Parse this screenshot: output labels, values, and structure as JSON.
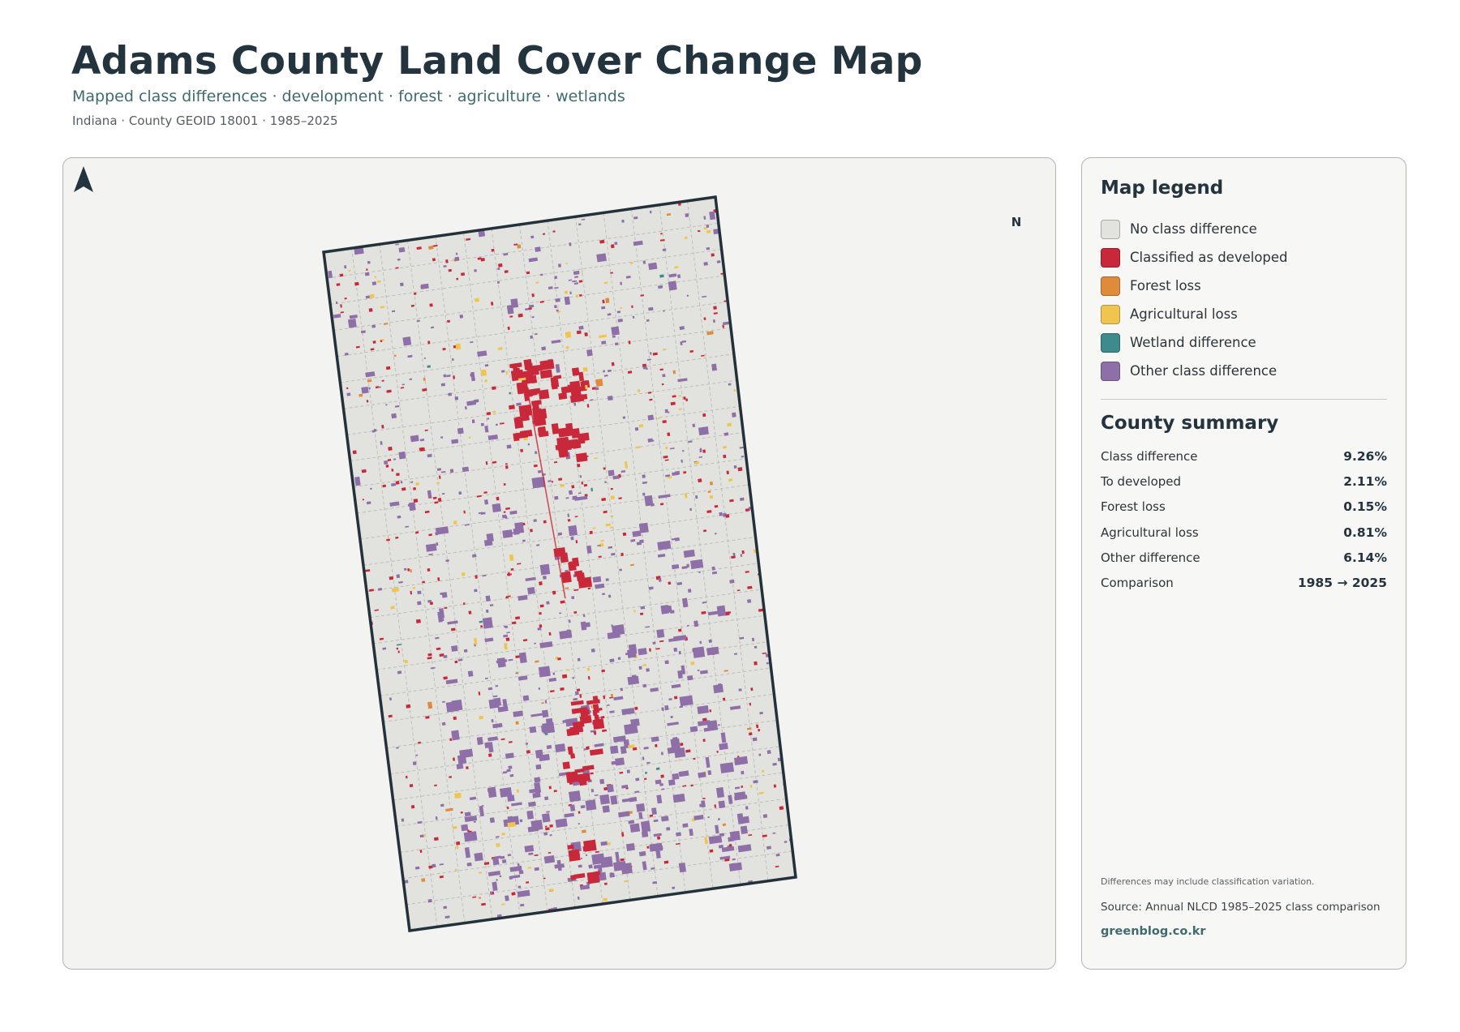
{
  "header": {
    "title": "Adams County Land Cover Change Map",
    "subtitle": "Mapped class differences · development · forest · agriculture · wetlands",
    "meta": "Indiana · County GEOID 18001 · 1985–2025"
  },
  "map": {
    "north_label": "N",
    "colors": {
      "background": "#e2e3de",
      "outline": "#22313a",
      "grid": "#bcbeb8",
      "developed": "#c9283a",
      "forest": "#e08a3c",
      "agricultural": "#f0c54f",
      "wetland": "#3f8a8c",
      "other": "#8f6fa8"
    }
  },
  "legend": {
    "heading": "Map legend",
    "items": [
      {
        "label": "No class difference",
        "color": "#e2e3de",
        "icon": "swatch-none"
      },
      {
        "label": "Classified as developed",
        "color": "#c9283a",
        "icon": "swatch-developed"
      },
      {
        "label": "Forest loss",
        "color": "#e08a3c",
        "icon": "swatch-forest"
      },
      {
        "label": "Agricultural loss",
        "color": "#f0c54f",
        "icon": "swatch-agricultural"
      },
      {
        "label": "Wetland difference",
        "color": "#3f8a8c",
        "icon": "swatch-wetland"
      },
      {
        "label": "Other class difference",
        "color": "#8f6fa8",
        "icon": "swatch-other"
      }
    ]
  },
  "summary": {
    "heading": "County summary",
    "rows": [
      {
        "label": "Class difference",
        "value": "9.26%"
      },
      {
        "label": "To developed",
        "value": "2.11%"
      },
      {
        "label": "Forest loss",
        "value": "0.15%"
      },
      {
        "label": "Agricultural loss",
        "value": "0.81%"
      },
      {
        "label": "Other difference",
        "value": "6.14%"
      },
      {
        "label": "Comparison",
        "value": "1985 → 2025"
      }
    ]
  },
  "footer": {
    "note": "Differences may include classification variation.",
    "source": "Source: Annual NLCD 1985–2025 class comparison",
    "credit": "greenblog.co.kr"
  }
}
